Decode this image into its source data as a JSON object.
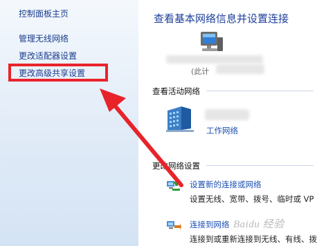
{
  "sidebar": {
    "home_label": "控制面板主页",
    "items": [
      {
        "label": "管理无线网络"
      },
      {
        "label": "更改适配器设置"
      },
      {
        "label": "更改高级共享设置"
      }
    ]
  },
  "main": {
    "title": "查看基本网络信息并设置连接",
    "computer_caption": "(此计",
    "active_networks_heading": "查看活动网络",
    "active_network_name": "工作网络",
    "change_settings_heading": "更改网络设置",
    "tasks": [
      {
        "title": "设置新的连接或网络",
        "description": "设置无线、宽带、拨号、临时或 VP"
      },
      {
        "title": "连接到网络",
        "description": "连接到或重新连接到无线、有线、拨"
      }
    ]
  },
  "watermark": "Baidu 经验",
  "colors": {
    "link": "#1a3d8c",
    "title": "#1d3f9a",
    "highlight": "#e8232a",
    "sidebar_bg": "#dfeaf7"
  },
  "icons": {
    "computer": "computer-icon",
    "network_building": "network-building-icon",
    "new_connection": "network-setup-icon",
    "connect": "connect-network-icon",
    "arrow": "red-arrow-annotation"
  }
}
